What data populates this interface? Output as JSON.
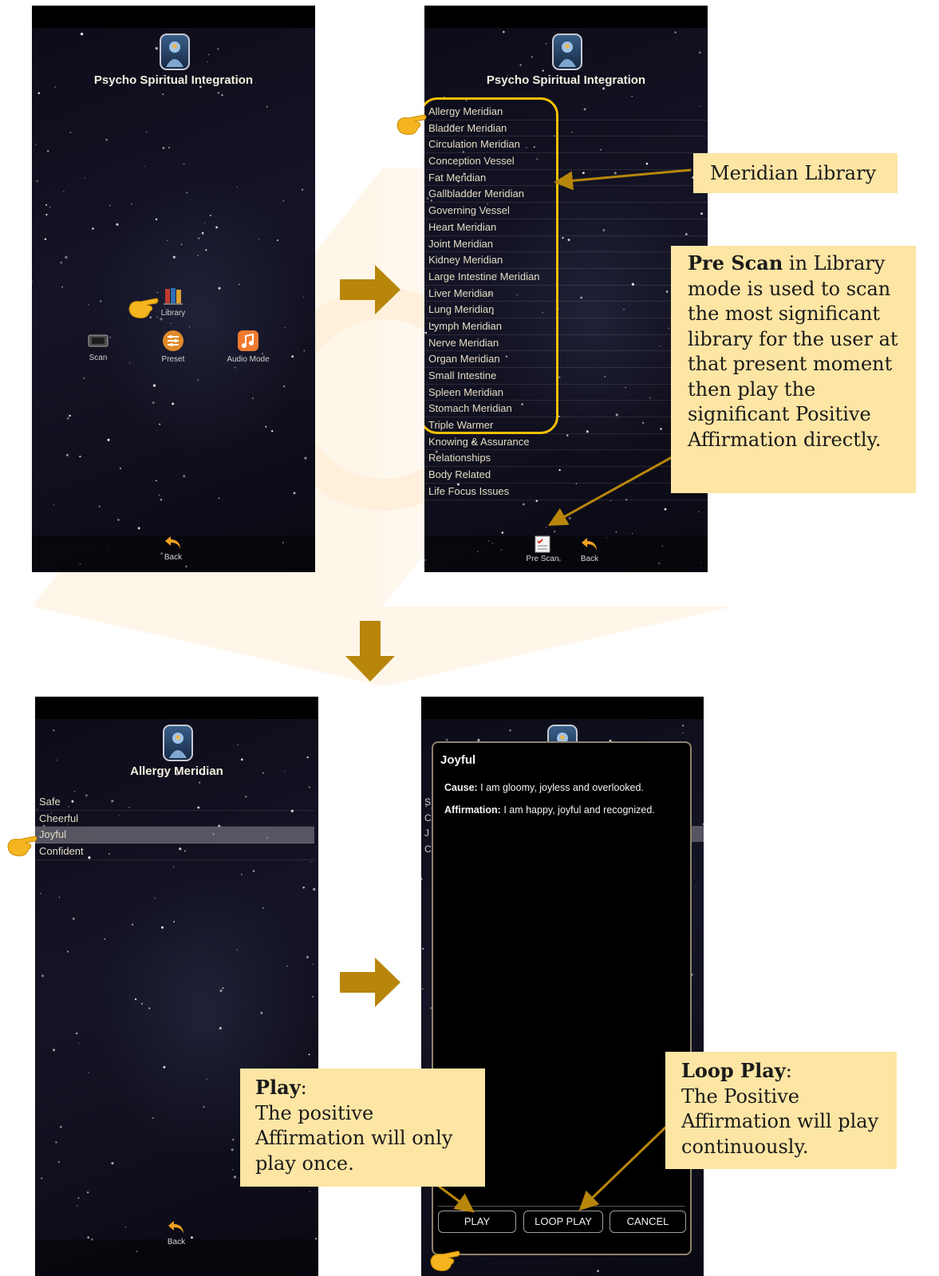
{
  "screen1": {
    "title": "Psycho Spiritual Integration",
    "library_label": "Library",
    "menu": [
      {
        "label": "Scan",
        "icon": "scan-icon"
      },
      {
        "label": "Preset",
        "icon": "preset-icon"
      },
      {
        "label": "Audio Mode",
        "icon": "music-note-icon"
      }
    ],
    "back_label": "Back"
  },
  "screen2": {
    "title": "Psycho Spiritual Integration",
    "library_items": [
      "Allergy Meridian",
      "Bladder Meridian",
      "Circulation Meridian",
      "Conception Vessel",
      "Fat Meridian",
      "Gallbladder Meridian",
      "Governing Vessel",
      "Heart Meridian",
      "Joint Meridian",
      "Kidney Meridian",
      "Large Intestine Meridian",
      "Liver Meridian",
      "Lung Meridian",
      "Lymph Meridian",
      "Nerve Meridian",
      "Organ Meridian",
      "Small Intestine",
      "Spleen Meridian",
      "Stomach Meridian",
      "Triple Warmer",
      "Knowing & Assurance",
      "Relationships",
      "Body Related",
      "Life Focus Issues"
    ],
    "prescan_label": "Pre Scan",
    "back_label": "Back"
  },
  "screen3": {
    "title": "Allergy Meridian",
    "items": [
      "Safe",
      "Cheerful",
      "Joyful",
      "Confident"
    ],
    "selected_item": "Joyful",
    "back_label": "Back"
  },
  "screen4": {
    "dialog_title": "Joyful",
    "cause_label": "Cause:",
    "cause_text": "I am gloomy, joyless and overlooked.",
    "affirmation_label": "Affirmation:",
    "affirmation_text": "I am happy, joyful and recognized.",
    "buttons": {
      "play": "PLAY",
      "loop_play": "LOOP PLAY",
      "cancel": "CANCEL"
    },
    "ghost_letters": [
      "S",
      "C",
      "J",
      "C"
    ]
  },
  "callouts": {
    "meridian_library": "Meridian Library",
    "prescan_bold": "Pre Scan",
    "prescan_text_1": " in Library mode is used to scan the most significant library for the user at that present moment then play the significant Positive Affirmation directly.",
    "play_bold": "Play",
    "play_colon": ":",
    "play_text": "The positive Affirmation will only play once.",
    "loop_bold": "Loop Play",
    "loop_colon": ":",
    "loop_text": "The Positive Affirmation will play continuously."
  },
  "colors": {
    "callout_bg": "#fde5a4",
    "arrow_gold": "#b8860b",
    "highlight_border": "#f5c000",
    "watermark": "#fff5e8"
  }
}
